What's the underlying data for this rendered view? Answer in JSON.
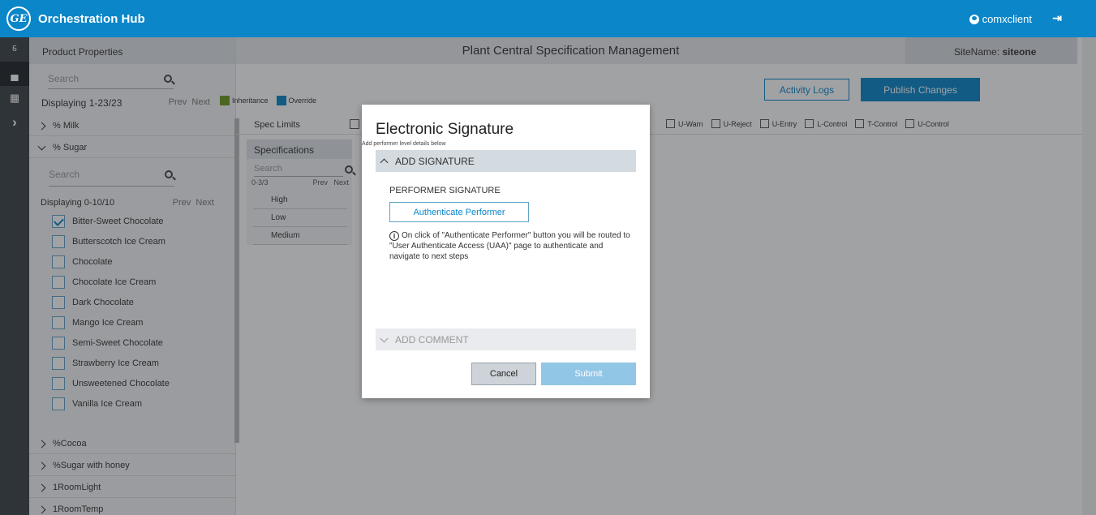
{
  "app": {
    "logo_text": "GE",
    "title": "Orchestration Hub",
    "user": "comxclient",
    "logout_icon": "logout-icon"
  },
  "rail": {
    "items": [
      "hierarchy-icon",
      "factory-icon",
      "grid-icon",
      "expand-icon"
    ]
  },
  "sidebar": {
    "header": "Product Properties",
    "search_placeholder": "Search",
    "displaying": "Displaying 1-23/23",
    "prev": "Prev",
    "next": "Next",
    "groups": [
      {
        "label": "% Milk",
        "expanded": false
      },
      {
        "label": "% Sugar",
        "expanded": true
      },
      {
        "label": "%Cocoa",
        "expanded": false
      },
      {
        "label": "%Sugar with honey",
        "expanded": false
      },
      {
        "label": "1RoomLight",
        "expanded": false
      },
      {
        "label": "1RoomTemp",
        "expanded": false
      }
    ],
    "sub": {
      "search_placeholder": "Search",
      "displaying": "Displaying 0-10/10",
      "prev": "Prev",
      "next": "Next",
      "items": [
        {
          "label": "Bitter-Sweet Chocolate",
          "checked": true
        },
        {
          "label": "Butterscotch Ice Cream",
          "checked": false
        },
        {
          "label": "Chocolate",
          "checked": false
        },
        {
          "label": "Chocolate Ice Cream",
          "checked": false
        },
        {
          "label": "Dark Chocolate",
          "checked": false
        },
        {
          "label": "Mango Ice Cream",
          "checked": false
        },
        {
          "label": "Semi-Sweet Chocolate",
          "checked": false
        },
        {
          "label": "Strawberry Ice Cream",
          "checked": false
        },
        {
          "label": "Unsweetened Chocolate",
          "checked": false
        },
        {
          "label": "Vanilla Ice Cream",
          "checked": false
        }
      ]
    }
  },
  "main": {
    "title": "Plant Central Specification Management",
    "sitename_label": "SiteName:",
    "sitename_value": "siteone",
    "legend": {
      "inheritance": "Inheritance",
      "override": "Override",
      "inheritance_color": "#6a9a1f",
      "override_color": "#0a86c9"
    },
    "activity_logs": "Activity Logs",
    "publish": "Publish Changes",
    "spec_limits": "Spec Limits",
    "filters": [
      "U-Warn",
      "U-Reject",
      "U-Entry",
      "L-Control",
      "T-Control",
      "U-Control"
    ],
    "specs": {
      "title": "Specifications",
      "search_placeholder": "Search",
      "range": "0-3/3",
      "prev": "Prev",
      "next": "Next",
      "rows": [
        "High",
        "Low",
        "Medium"
      ]
    }
  },
  "modal": {
    "title": "Electronic Signature",
    "subtitle": "Add performer level details below",
    "add_signature": "ADD SIGNATURE",
    "performer_label": "PERFORMER SIGNATURE",
    "authenticate_button": "Authenticate Performer",
    "info_text": "On click of \"Authenticate Performer\" button you will be routed to \"User Authenticate Access (UAA)\" page to authenticate and navigate to next steps",
    "add_comment": "ADD COMMENT",
    "cancel": "Cancel",
    "submit": "Submit"
  }
}
